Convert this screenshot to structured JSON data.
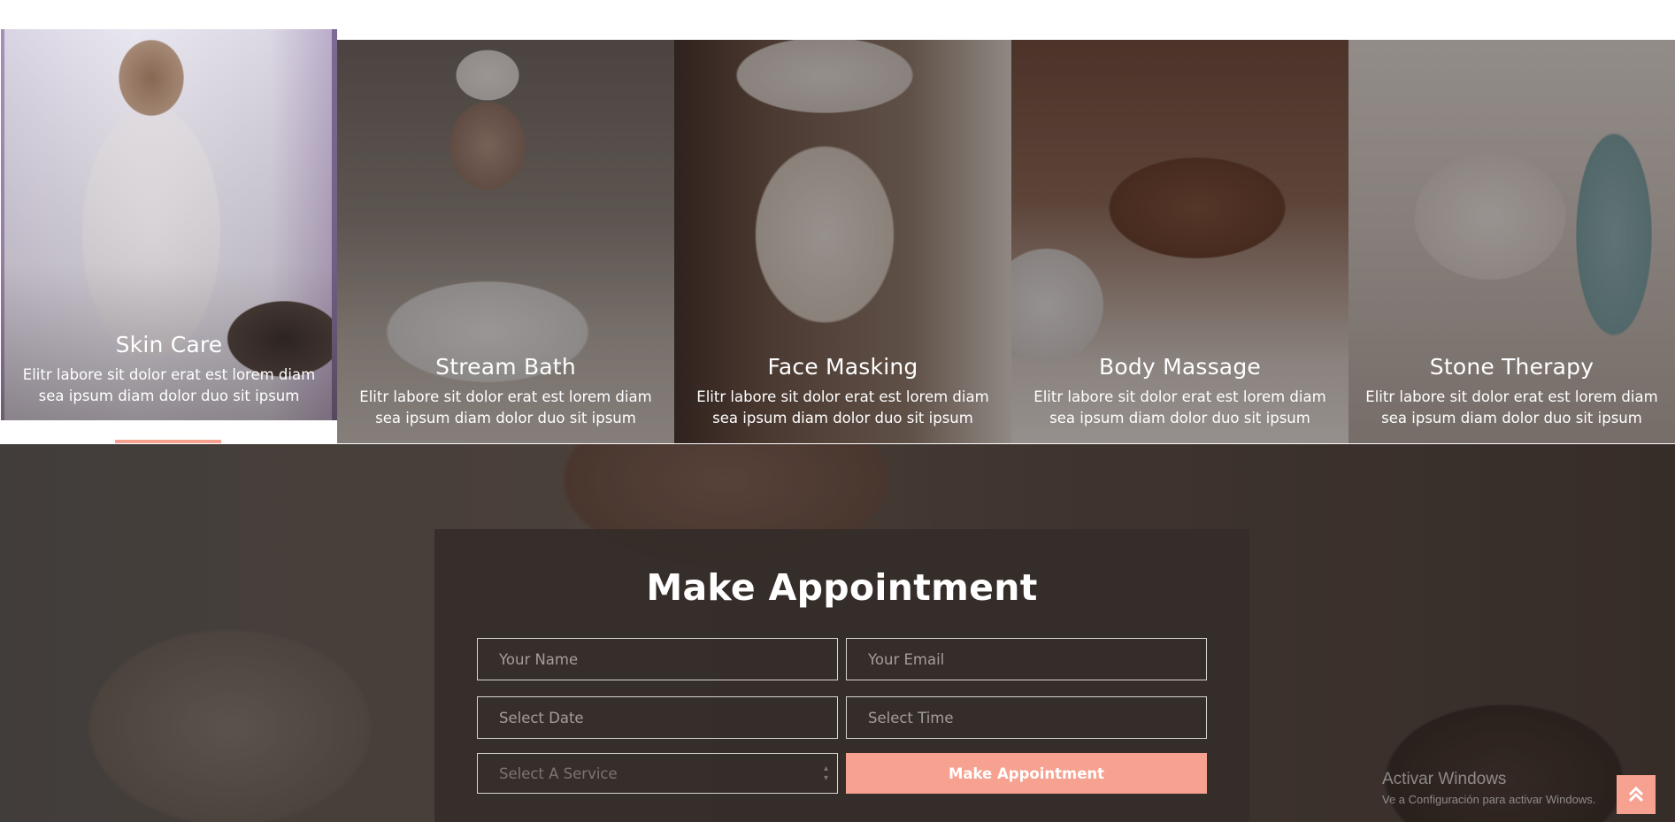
{
  "services": [
    {
      "title": "Skin Care",
      "desc": "Elitr labore sit dolor erat est lorem diam sea ipsum diam dolor duo sit ipsum"
    },
    {
      "title": "Stream Bath",
      "desc": "Elitr labore sit dolor erat est lorem diam sea ipsum diam dolor duo sit ipsum"
    },
    {
      "title": "Face Masking",
      "desc": "Elitr labore sit dolor erat est lorem diam sea ipsum diam dolor duo sit ipsum"
    },
    {
      "title": "Body Massage",
      "desc": "Elitr labore sit dolor erat est lorem diam sea ipsum diam dolor duo sit ipsum"
    },
    {
      "title": "Stone Therapy",
      "desc": "Elitr labore sit dolor erat est lorem diam sea ipsum diam dolor duo sit ipsum"
    }
  ],
  "appointment": {
    "title": "Make Appointment",
    "name_placeholder": "Your Name",
    "email_placeholder": "Your Email",
    "date_placeholder": "Select Date",
    "time_placeholder": "Select Time",
    "service_placeholder": "Select A Service",
    "submit_label": "Make Appointment"
  },
  "watermark": {
    "title": "Activar Windows",
    "subtitle": "Ve a Configuración para activar Windows."
  },
  "icons": {
    "back_to_top": "double-chevron-up-icon",
    "select_arrow": "updown-arrow-icon"
  },
  "colors": {
    "accent": "#f7a291",
    "form_bg": "#342c29"
  }
}
